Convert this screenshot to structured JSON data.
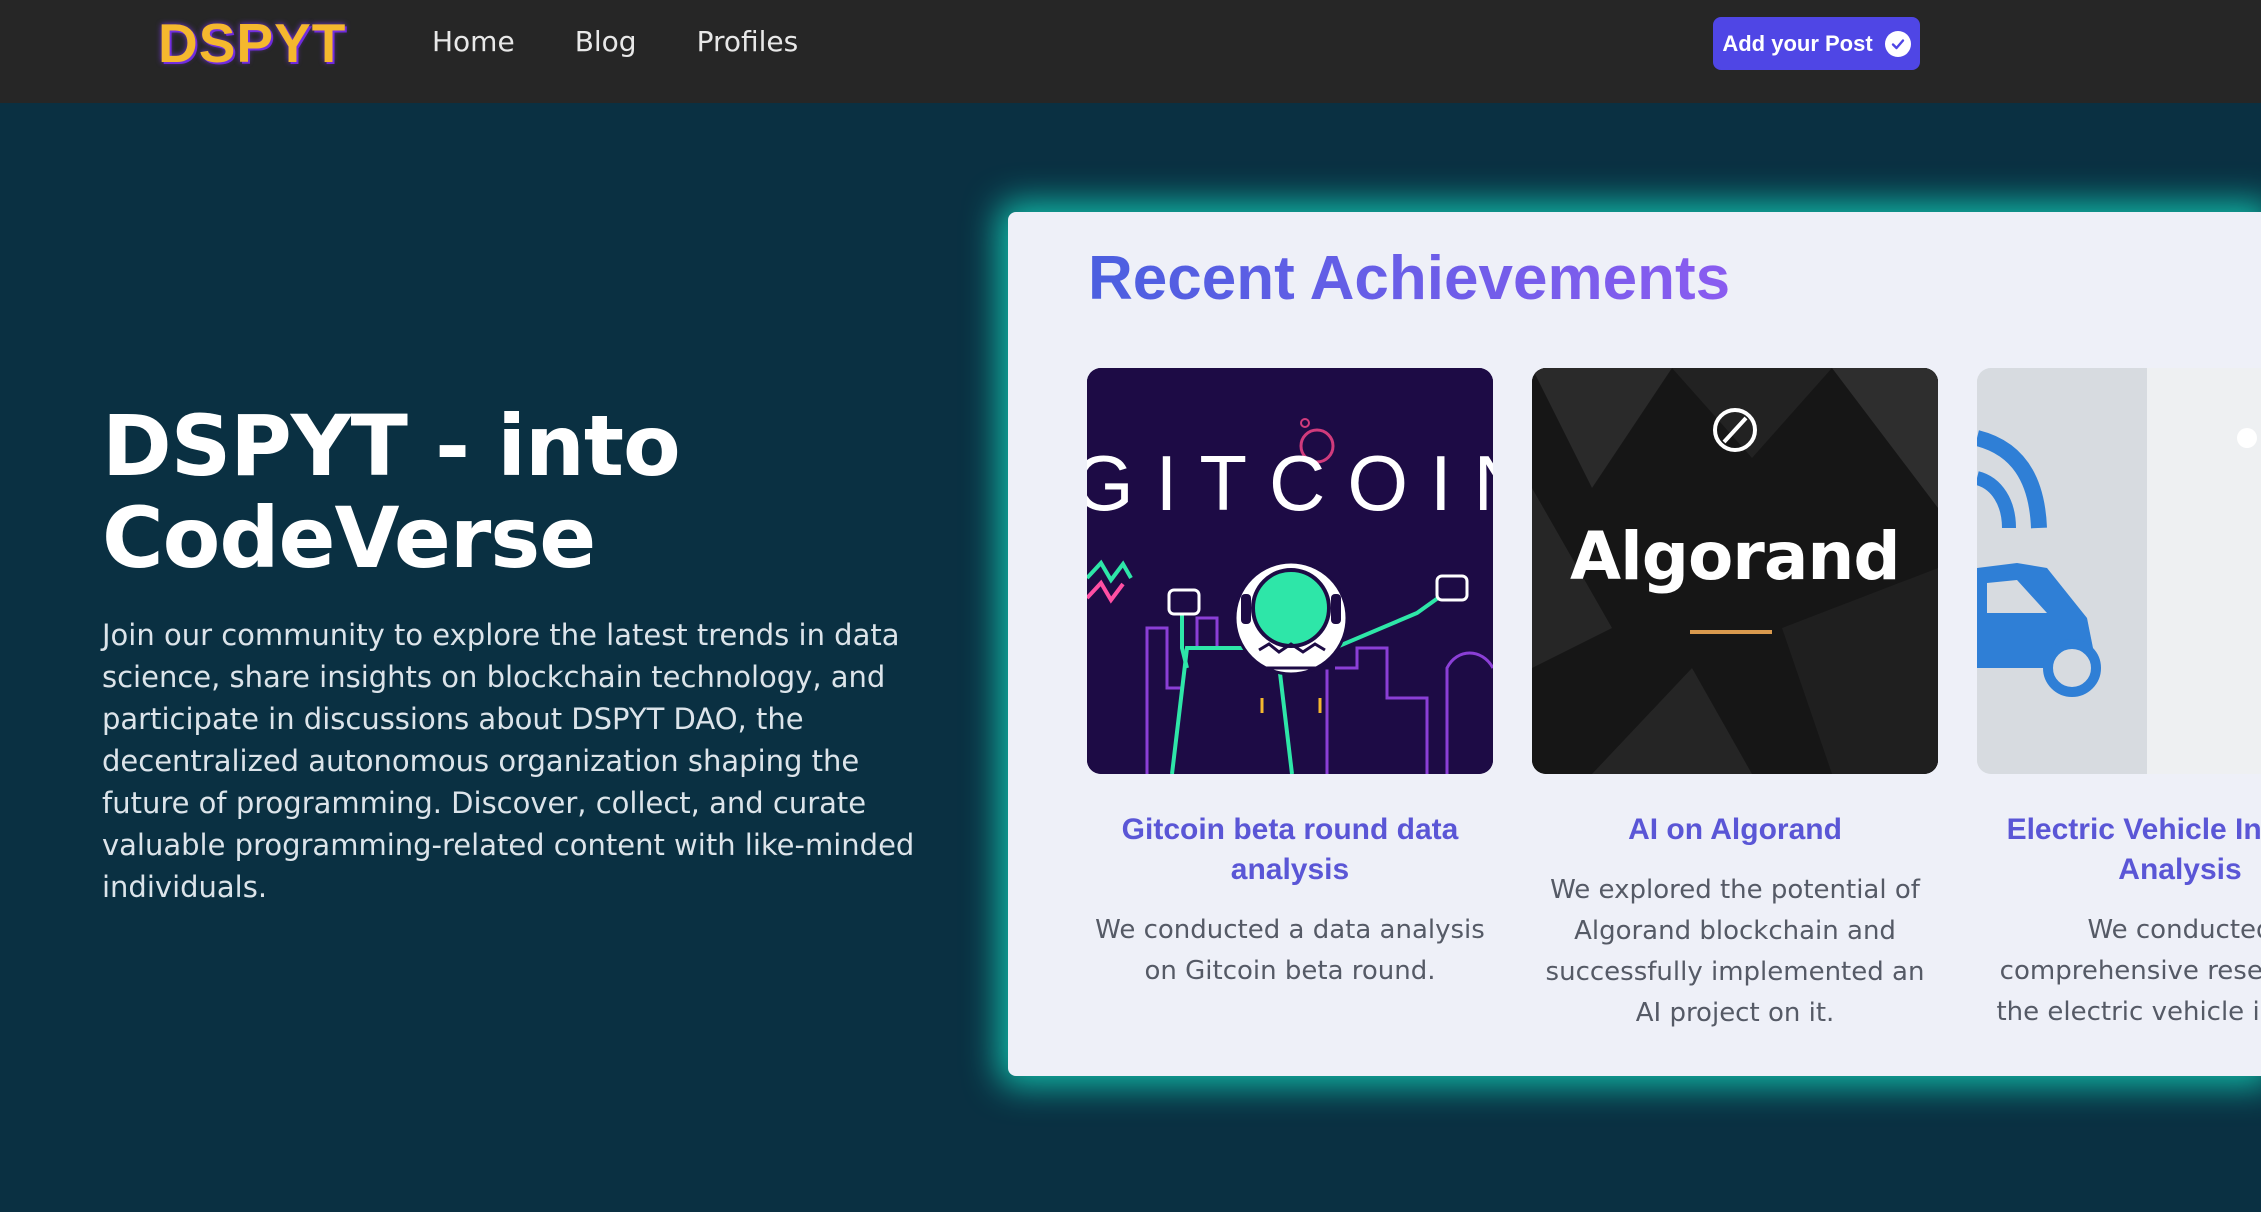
{
  "navbar": {
    "logo": "DSPYT",
    "links": [
      "Home",
      "Blog",
      "Profiles"
    ],
    "add_post_label": "Add your Post"
  },
  "hero": {
    "title": "DSPYT - into CodeVerse",
    "description": "Join our community to explore the latest trends in data science, share insights on blockchain technology, and participate in discussions about DSPYT DAO, the decentralized autonomous organization shaping the future of programming. Discover, collect, and curate valuable programming-related content with like-minded individuals."
  },
  "achievements": {
    "title": "Recent Achievements",
    "cards": [
      {
        "image_text": "GITCOIN",
        "title": "Gitcoin beta round data analysis",
        "description": "We conducted a data analysis on Gitcoin beta round."
      },
      {
        "image_text": "Algorand",
        "title": "AI on Algorand",
        "description": "We explored the potential of Algorand blockchain and successfully implemented an AI project on it."
      },
      {
        "title": "Electric Vehicle Industry Analysis",
        "description": "We conducted comprehensive research on the electric vehicle industry."
      }
    ]
  },
  "colors": {
    "page_bg": "#0a3042",
    "navbar_bg": "#262626",
    "logo": "#f5b82e",
    "button": "#4f46e5",
    "panel_glow": "#14e6c8",
    "card_title": "#5a56d6"
  }
}
